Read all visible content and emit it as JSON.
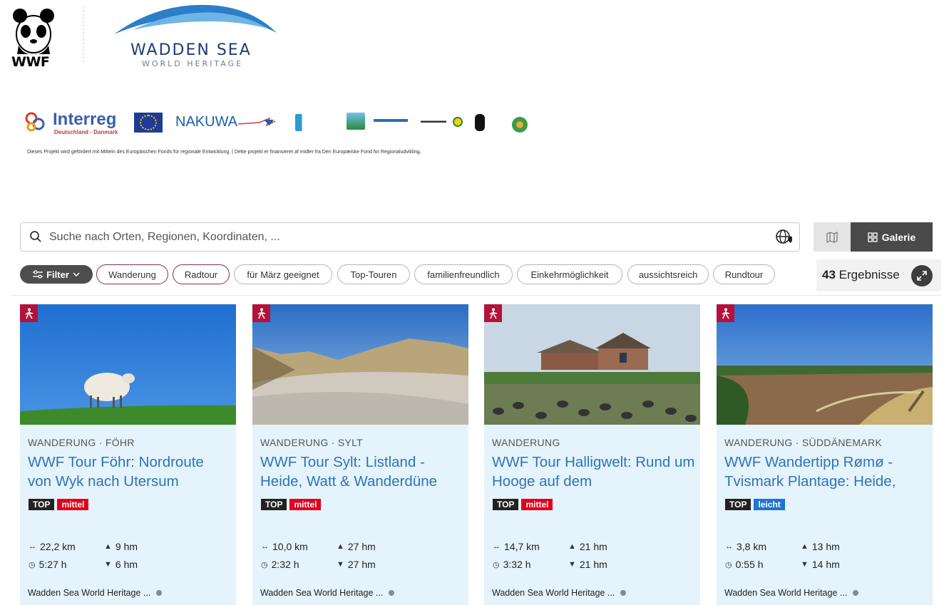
{
  "header": {
    "wwf_label": "WWF",
    "wadden_title": "WADDEN SEA",
    "wadden_subtitle": "WORLD HERITAGE"
  },
  "partners": {
    "interreg": "Interreg",
    "interreg_sub": "Deutschland - Danmark",
    "nakuwa": "NAKUWA",
    "funding_note": "Dieses Projekt wird gefördert mit Mitteln des Europäischen Fonds für regionale Entwicklung.  |  Dette projekt er finansieret af midler fra Den Europæiske Fond for Regionaludvikling."
  },
  "search": {
    "placeholder": "Suche nach Orten, Regionen, Koordinaten, ..."
  },
  "view_toggle": {
    "gallery_label": "Galerie"
  },
  "filters": {
    "filter_label": "Filter",
    "chips": [
      "Wanderung",
      "Radtour",
      "für März geeignet",
      "Top-Touren",
      "familienfreundlich",
      "Einkehrmöglichkeit",
      "aussichtsreich",
      "Rundtour"
    ]
  },
  "results": {
    "count": "43",
    "label": "Ergebnisse"
  },
  "cards": [
    {
      "category": "WANDERUNG · FÖHR",
      "title": "WWF Tour Föhr: Nordroute von Wyk nach Utersum",
      "tags": [
        "TOP",
        "mittel"
      ],
      "distance": "22,2 km",
      "duration": "5:27 h",
      "ascent": "9 hm",
      "descent": "6 hm",
      "source": "Wadden Sea World Heritage ..."
    },
    {
      "category": "WANDERUNG · SYLT",
      "title": "WWF Tour Sylt: Listland - Heide, Watt & Wanderdüne",
      "tags": [
        "TOP",
        "mittel"
      ],
      "distance": "10,0 km",
      "duration": "2:32 h",
      "ascent": "27 hm",
      "descent": "27 hm",
      "source": "Wadden Sea World Heritage ..."
    },
    {
      "category": "WANDERUNG",
      "title": "WWF Tour Halligwelt: Rund um Hooge auf dem",
      "tags": [
        "TOP",
        "mittel"
      ],
      "distance": "14,7 km",
      "duration": "3:32 h",
      "ascent": "21 hm",
      "descent": "21 hm",
      "source": "Wadden Sea World Heritage ..."
    },
    {
      "category": "WANDERUNG · SÜDDÄNEMARK",
      "title": "WWF Wandertipp Rømø - Tvismark Plantage: Heide,",
      "tags": [
        "TOP",
        "leicht"
      ],
      "distance": "3,8 km",
      "duration": "0:55 h",
      "ascent": "13 hm",
      "descent": "14 hm",
      "source": "Wadden Sea World Heritage ..."
    }
  ]
}
